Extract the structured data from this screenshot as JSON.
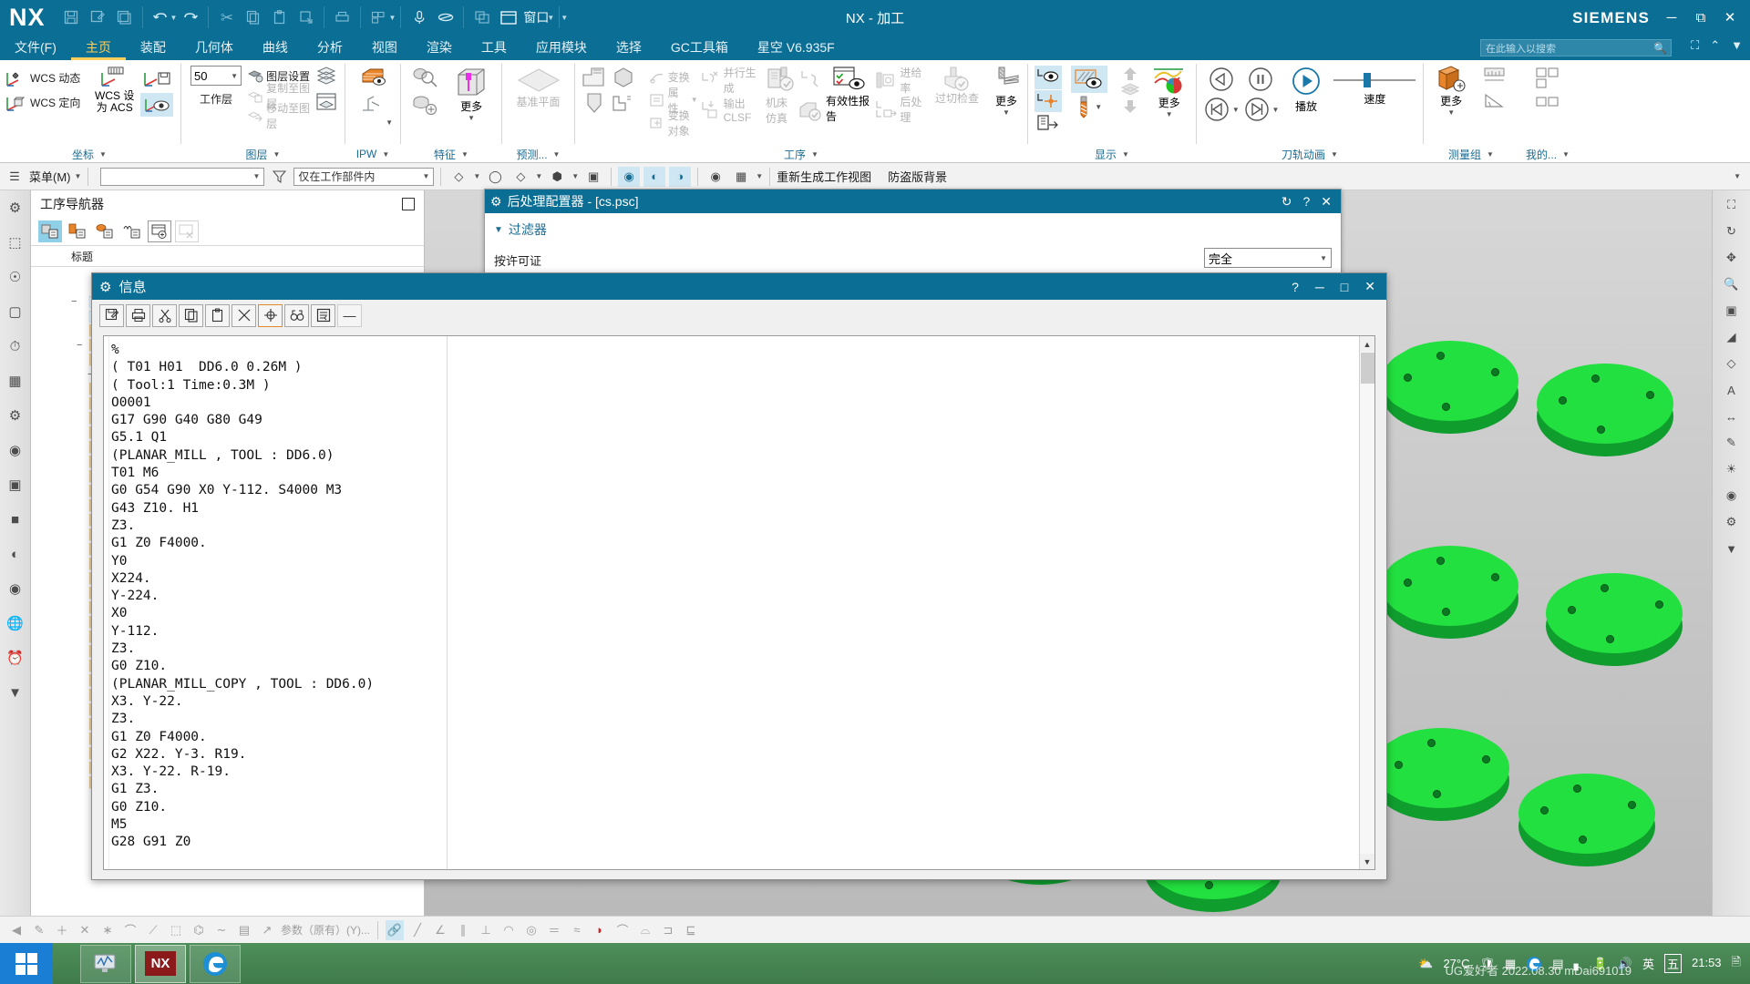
{
  "titlebar": {
    "logo": "NX",
    "app_title": "NX - 加工",
    "brand": "SIEMENS",
    "window_label": "窗口",
    "quick_access": [
      {
        "name": "save-icon",
        "glyph": "💾"
      },
      {
        "name": "save-as-icon",
        "glyph": "🖫"
      },
      {
        "name": "save-all-icon",
        "glyph": "🗂"
      },
      {
        "name": "undo-icon",
        "glyph": "↶"
      },
      {
        "name": "redo-icon",
        "glyph": "↷"
      },
      {
        "name": "cut-icon",
        "glyph": "✂"
      },
      {
        "name": "copy-icon",
        "glyph": "❐"
      },
      {
        "name": "paste-icon",
        "glyph": "📋"
      },
      {
        "name": "paste-special-icon",
        "glyph": "⧉"
      },
      {
        "name": "print-icon",
        "glyph": "⎙"
      },
      {
        "name": "command-finder-icon",
        "glyph": "⌸"
      },
      {
        "name": "voice-icon",
        "glyph": "🎙"
      },
      {
        "name": "eraser-icon",
        "glyph": "⌑"
      },
      {
        "name": "window-tile-icon",
        "glyph": "⧉"
      },
      {
        "name": "window-icon",
        "glyph": "▢"
      }
    ],
    "window_buttons": [
      {
        "name": "minimize-button",
        "glyph": "–"
      },
      {
        "name": "restore-button",
        "glyph": "❐"
      },
      {
        "name": "close-button",
        "glyph": "✕"
      }
    ]
  },
  "tabs": [
    {
      "label": "文件(F)",
      "active": false
    },
    {
      "label": "主页",
      "active": true
    },
    {
      "label": "装配",
      "active": false
    },
    {
      "label": "几何体",
      "active": false
    },
    {
      "label": "曲线",
      "active": false
    },
    {
      "label": "分析",
      "active": false
    },
    {
      "label": "视图",
      "active": false
    },
    {
      "label": "渲染",
      "active": false
    },
    {
      "label": "工具",
      "active": false
    },
    {
      "label": "应用模块",
      "active": false
    },
    {
      "label": "选择",
      "active": false
    },
    {
      "label": "GC工具箱",
      "active": false
    },
    {
      "label": "星空 V6.935F",
      "active": false
    }
  ],
  "search": {
    "placeholder": "在此输入以搜索"
  },
  "ribbon": {
    "groups": [
      {
        "title": "坐标",
        "items": [
          {
            "label": "WCS 动态",
            "icon": "wcs-dynamic-icon",
            "disabled": false
          },
          {
            "label": "WCS 定向",
            "icon": "wcs-orient-icon",
            "disabled": false
          },
          {
            "label": "WCS 设为 ACS",
            "icon": "wcs-to-acs-icon",
            "disabled": false
          },
          {
            "label": "",
            "icon": "wcs-display-icon",
            "disabled": false
          },
          {
            "label": "",
            "icon": "wcs-save-icon",
            "disabled": false
          }
        ]
      },
      {
        "title": "图层",
        "work_layer_value": "50",
        "work_layer_label": "工作层",
        "items": [
          {
            "label": "图层设置",
            "icon": "layer-settings-icon",
            "disabled": false
          },
          {
            "label": "复制至图层",
            "icon": "copy-to-layer-icon",
            "disabled": true
          },
          {
            "label": "移动至图层",
            "icon": "move-to-layer-icon",
            "disabled": true
          },
          {
            "label": "",
            "icon": "layer-stack-icon",
            "disabled": false
          },
          {
            "label": "",
            "icon": "layer-visible-icon",
            "disabled": false
          }
        ]
      },
      {
        "title": "IPW",
        "items": [
          {
            "label": "",
            "icon": "ipw-solid-icon",
            "disabled": false
          },
          {
            "label": "",
            "icon": "ipw-tool-icon",
            "disabled": false
          }
        ]
      },
      {
        "title": "特征",
        "items": [
          {
            "label": "更多",
            "icon": "feature-more-icon",
            "disabled": false
          },
          {
            "label": "",
            "icon": "feature-search-icon",
            "disabled": false
          },
          {
            "label": "",
            "icon": "feature-add-icon",
            "disabled": false
          }
        ]
      },
      {
        "title": "预测...",
        "items": [
          {
            "label": "基准平面",
            "icon": "datum-plane-icon",
            "disabled": true
          },
          {
            "label": "",
            "icon": "step-feature-icon",
            "disabled": false
          },
          {
            "label": "",
            "icon": "pocket-feature-icon",
            "disabled": false
          },
          {
            "label": "",
            "icon": "hole-feature-icon",
            "disabled": false
          },
          {
            "label": "",
            "icon": "slot-feature-icon",
            "disabled": false
          },
          {
            "label": "",
            "icon": "corner-feature-icon",
            "disabled": false
          }
        ]
      },
      {
        "title": "工序",
        "items": [
          {
            "label": "变换",
            "icon": "transform-icon",
            "disabled": true
          },
          {
            "label": "属性",
            "icon": "properties-icon",
            "disabled": true
          },
          {
            "label": "变换对象",
            "icon": "transform-object-icon",
            "disabled": true
          },
          {
            "label": "并行生成",
            "icon": "parallel-generate-icon",
            "disabled": true
          },
          {
            "label": "输出 CLSF",
            "icon": "output-clsf-icon",
            "disabled": true
          },
          {
            "label": "机床仿真",
            "icon": "machine-simulation-icon",
            "disabled": true
          },
          {
            "label": "有效性报告",
            "icon": "validity-report-icon",
            "disabled": false
          },
          {
            "label": "进给率",
            "icon": "feedrate-icon",
            "disabled": true
          },
          {
            "label": "后处理",
            "icon": "post-process-icon",
            "disabled": true
          },
          {
            "label": "过切检查",
            "icon": "gouge-check-icon",
            "disabled": true
          },
          {
            "label": "更多",
            "icon": "operation-more-icon",
            "disabled": false
          }
        ]
      },
      {
        "title": "显示",
        "items": [
          {
            "label": "",
            "icon": "display-toolpath-icon",
            "disabled": false
          },
          {
            "label": "",
            "icon": "display-section-icon",
            "disabled": false
          },
          {
            "label": "",
            "icon": "display-point-icon",
            "disabled": false
          },
          {
            "label": "",
            "icon": "display-export-icon",
            "disabled": false
          },
          {
            "label": "",
            "icon": "display-tool-icon",
            "disabled": false
          },
          {
            "label": "",
            "icon": "move-up-icon",
            "disabled": true
          },
          {
            "label": "",
            "icon": "layers-icon",
            "disabled": true
          },
          {
            "label": "",
            "icon": "move-down-icon",
            "disabled": true
          },
          {
            "label": "更多",
            "icon": "display-more-icon",
            "disabled": false
          }
        ]
      },
      {
        "title": "刀轨动画",
        "play_label": "播放",
        "speed_label": "速度",
        "items": [
          {
            "label": "",
            "icon": "step-backward-icon",
            "disabled": false
          },
          {
            "label": "",
            "icon": "pause-icon",
            "disabled": false
          },
          {
            "label": "",
            "icon": "play-icon",
            "disabled": false
          },
          {
            "label": "",
            "icon": "rewind-icon",
            "disabled": false
          },
          {
            "label": "",
            "icon": "forward-icon",
            "disabled": false
          }
        ]
      },
      {
        "title": "测量组",
        "items": [
          {
            "label": "更多",
            "icon": "measure-more-icon",
            "disabled": false
          },
          {
            "label": "",
            "icon": "measure-distance-icon",
            "disabled": false
          },
          {
            "label": "",
            "icon": "measure-angle-icon",
            "disabled": false
          }
        ]
      },
      {
        "title": "我的...",
        "items": [
          {
            "label": "",
            "icon": "my-item-icon",
            "disabled": false
          }
        ]
      }
    ]
  },
  "toolbar2": {
    "menu_label": "菜单(M)",
    "combo1_value": "",
    "combo2_value": "仅在工作部件内",
    "buttons": [
      {
        "name": "select-filter-icon",
        "glyph": "◈"
      },
      {
        "name": "snap-point-icon",
        "glyph": "⬚"
      },
      {
        "name": "curve-rule-icon",
        "glyph": "○"
      },
      {
        "name": "face-rule-icon",
        "glyph": "◇"
      },
      {
        "name": "body-rule-icon",
        "glyph": "⬢"
      },
      {
        "name": "highlight-icon",
        "glyph": "▣"
      }
    ],
    "regen_label": "重新生成工作视图",
    "anti_piracy_label": "防盗版背景"
  },
  "navigator": {
    "title": "工序导航器",
    "column_header": "标题",
    "tools": [
      {
        "name": "program-order-view-icon",
        "selected": true
      },
      {
        "name": "machine-tool-view-icon",
        "selected": false
      },
      {
        "name": "geometry-view-icon",
        "selected": false
      },
      {
        "name": "machining-method-view-icon",
        "selected": false
      },
      {
        "name": "new-window-icon",
        "selected": false
      },
      {
        "name": "close-window-icon",
        "selected": false
      }
    ]
  },
  "post_dialog": {
    "title": "后处理配置器 - [cs.psc]",
    "section_label": "过滤器",
    "field_label": "按许可证",
    "field_value": "完全",
    "buttons": [
      {
        "name": "refresh-icon",
        "glyph": "↻"
      },
      {
        "name": "help-icon",
        "glyph": "?"
      },
      {
        "name": "close-icon",
        "glyph": "✕"
      }
    ]
  },
  "info_dialog": {
    "title": "信息",
    "window_buttons": [
      {
        "name": "help-button",
        "glyph": "?"
      },
      {
        "name": "minimize-button",
        "glyph": "–"
      },
      {
        "name": "maximize-button",
        "glyph": "⬜"
      },
      {
        "name": "close-button",
        "glyph": "✕"
      }
    ],
    "toolbar": [
      {
        "name": "save-as-icon",
        "glyph": "🖫"
      },
      {
        "name": "print-icon",
        "glyph": "⎙"
      },
      {
        "name": "cut-icon",
        "glyph": "✂"
      },
      {
        "name": "copy-icon",
        "glyph": "❐"
      },
      {
        "name": "paste-icon",
        "glyph": "📋"
      },
      {
        "name": "delete-icon",
        "glyph": "✕"
      },
      {
        "name": "locate-icon",
        "glyph": "⊕"
      },
      {
        "name": "find-icon",
        "glyph": "♋"
      },
      {
        "name": "word-wrap-icon",
        "glyph": "≡"
      },
      {
        "name": "minimize-icon",
        "glyph": "—"
      }
    ],
    "content": "%\n( T01 H01  DD6.0 0.26M )\n( Tool:1 Time:0.3M )\nO0001\nG17 G90 G40 G80 G49\nG5.1 Q1\n(PLANAR_MILL , TOOL : DD6.0)\nT01 M6\nG0 G54 G90 X0 Y-112. S4000 M3\nG43 Z10. H1\nZ3.\nG1 Z0 F4000.\nY0\nX224.\nY-224.\nX0\nY-112.\nZ3.\nG0 Z10.\n(PLANAR_MILL_COPY , TOOL : DD6.0)\nX3. Y-22.\nZ3.\nG1 Z0 F4000.\nG2 X22. Y-3. R19.\nX3. Y-22. R-19.\nG1 Z3.\nG0 Z10.\nM5\nG28 G91 Z0"
  },
  "bottom_strip": {
    "params_label": "参数（原有）(Y)...",
    "icons": [
      {
        "name": "sketch-icon",
        "glyph": "✎"
      },
      {
        "name": "point-icon",
        "glyph": "＋"
      },
      {
        "name": "intersect-icon",
        "glyph": "✕"
      },
      {
        "name": "midpoint-icon",
        "glyph": "∗"
      },
      {
        "name": "arc-icon",
        "glyph": "⌒"
      },
      {
        "name": "curve-icon",
        "glyph": "⟋"
      },
      {
        "name": "sheet-icon",
        "glyph": "⬚"
      },
      {
        "name": "tangent-icon",
        "glyph": "⌬"
      },
      {
        "name": "spline-icon",
        "glyph": "∼"
      },
      {
        "name": "measure-icon",
        "glyph": "▤"
      },
      {
        "name": "offset-icon",
        "glyph": "↗"
      }
    ],
    "right_icons": [
      {
        "name": "link-icon",
        "glyph": "🔗",
        "selected": true
      },
      {
        "name": "line-icon",
        "glyph": "╱"
      },
      {
        "name": "angle-icon",
        "glyph": "∠"
      },
      {
        "name": "parallel-icon",
        "glyph": "∥"
      },
      {
        "name": "perpendicular-icon",
        "glyph": "⊥"
      },
      {
        "name": "tangent2-icon",
        "glyph": "◠"
      },
      {
        "name": "concentric-icon",
        "glyph": "◎"
      },
      {
        "name": "equal-icon",
        "glyph": "＝"
      },
      {
        "name": "symmetric-icon",
        "glyph": "≈"
      },
      {
        "name": "grid-icon",
        "glyph": "⌗",
        "red": true
      },
      {
        "name": "fillet-icon",
        "glyph": "⌒"
      },
      {
        "name": "chamfer-icon",
        "glyph": "⌓"
      },
      {
        "name": "trim-icon",
        "glyph": "⊐"
      },
      {
        "name": "extend-icon",
        "glyph": "⊑"
      }
    ]
  },
  "taskbar": {
    "apps": [
      {
        "name": "taskbar-monitor-app",
        "label": "",
        "active": false
      },
      {
        "name": "taskbar-nx-app",
        "label": "NX",
        "active": true
      },
      {
        "name": "taskbar-edge-app",
        "label": "e",
        "active": false
      }
    ],
    "tray": {
      "temperature": "27°C",
      "ime": "英",
      "ime2": "五",
      "time": "21:53",
      "icons": [
        {
          "name": "weather-icon",
          "glyph": "⛅"
        },
        {
          "name": "security-shield-icon",
          "glyph": "🛡"
        },
        {
          "name": "keyboard-icon",
          "glyph": "⌨"
        },
        {
          "name": "edge-icon",
          "glyph": "e"
        },
        {
          "name": "app-icon",
          "glyph": "▦"
        },
        {
          "name": "network-icon",
          "glyph": "◢"
        },
        {
          "name": "battery-icon",
          "glyph": "🔋"
        },
        {
          "name": "volume-icon",
          "glyph": "🔊"
        }
      ]
    },
    "watermark": "UG爱好者 2022.08.30 mDai691019"
  }
}
